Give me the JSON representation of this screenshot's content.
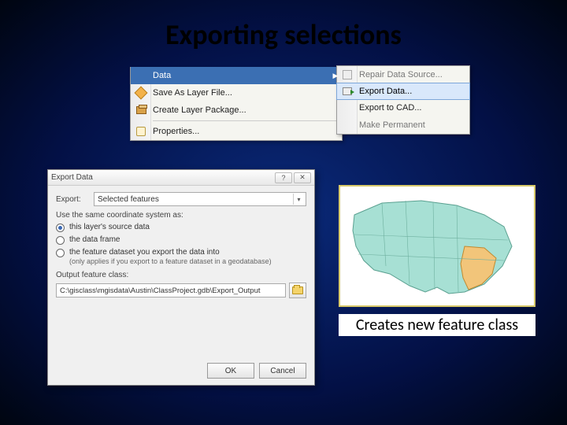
{
  "title": "Exporting selections",
  "menu": {
    "items": [
      {
        "label": "Data",
        "selected": true,
        "has_submenu": true
      },
      {
        "label": "Save As Layer File...",
        "icon": "diamond"
      },
      {
        "label": "Create Layer Package...",
        "icon": "box"
      },
      {
        "label": "Properties...",
        "icon": "hand",
        "sep_before": true
      }
    ]
  },
  "submenu": {
    "items": [
      {
        "label": "Repair Data Source...",
        "enabled": false,
        "icon": "repair"
      },
      {
        "label": "Export Data...",
        "enabled": true,
        "selected": true,
        "icon": "export"
      },
      {
        "label": "Export to CAD...",
        "enabled": true
      },
      {
        "label": "Make Permanent",
        "enabled": false
      }
    ]
  },
  "dialog": {
    "title": "Export Data",
    "export_label": "Export:",
    "export_value": "Selected features",
    "coord_title": "Use the same coordinate system as:",
    "radios": [
      {
        "label": "this layer's source data",
        "checked": true
      },
      {
        "label": "the data frame",
        "checked": false
      },
      {
        "label": "the feature dataset you export the data into",
        "sub": "(only applies if you export to a feature dataset in a geodatabase)",
        "checked": false
      }
    ],
    "output_label": "Output feature class:",
    "output_path": "C:\\gisclass\\mgisdata\\Austin\\ClassProject.gdb\\Export_Output",
    "ok": "OK",
    "cancel": "Cancel"
  },
  "caption": "Creates new feature class"
}
